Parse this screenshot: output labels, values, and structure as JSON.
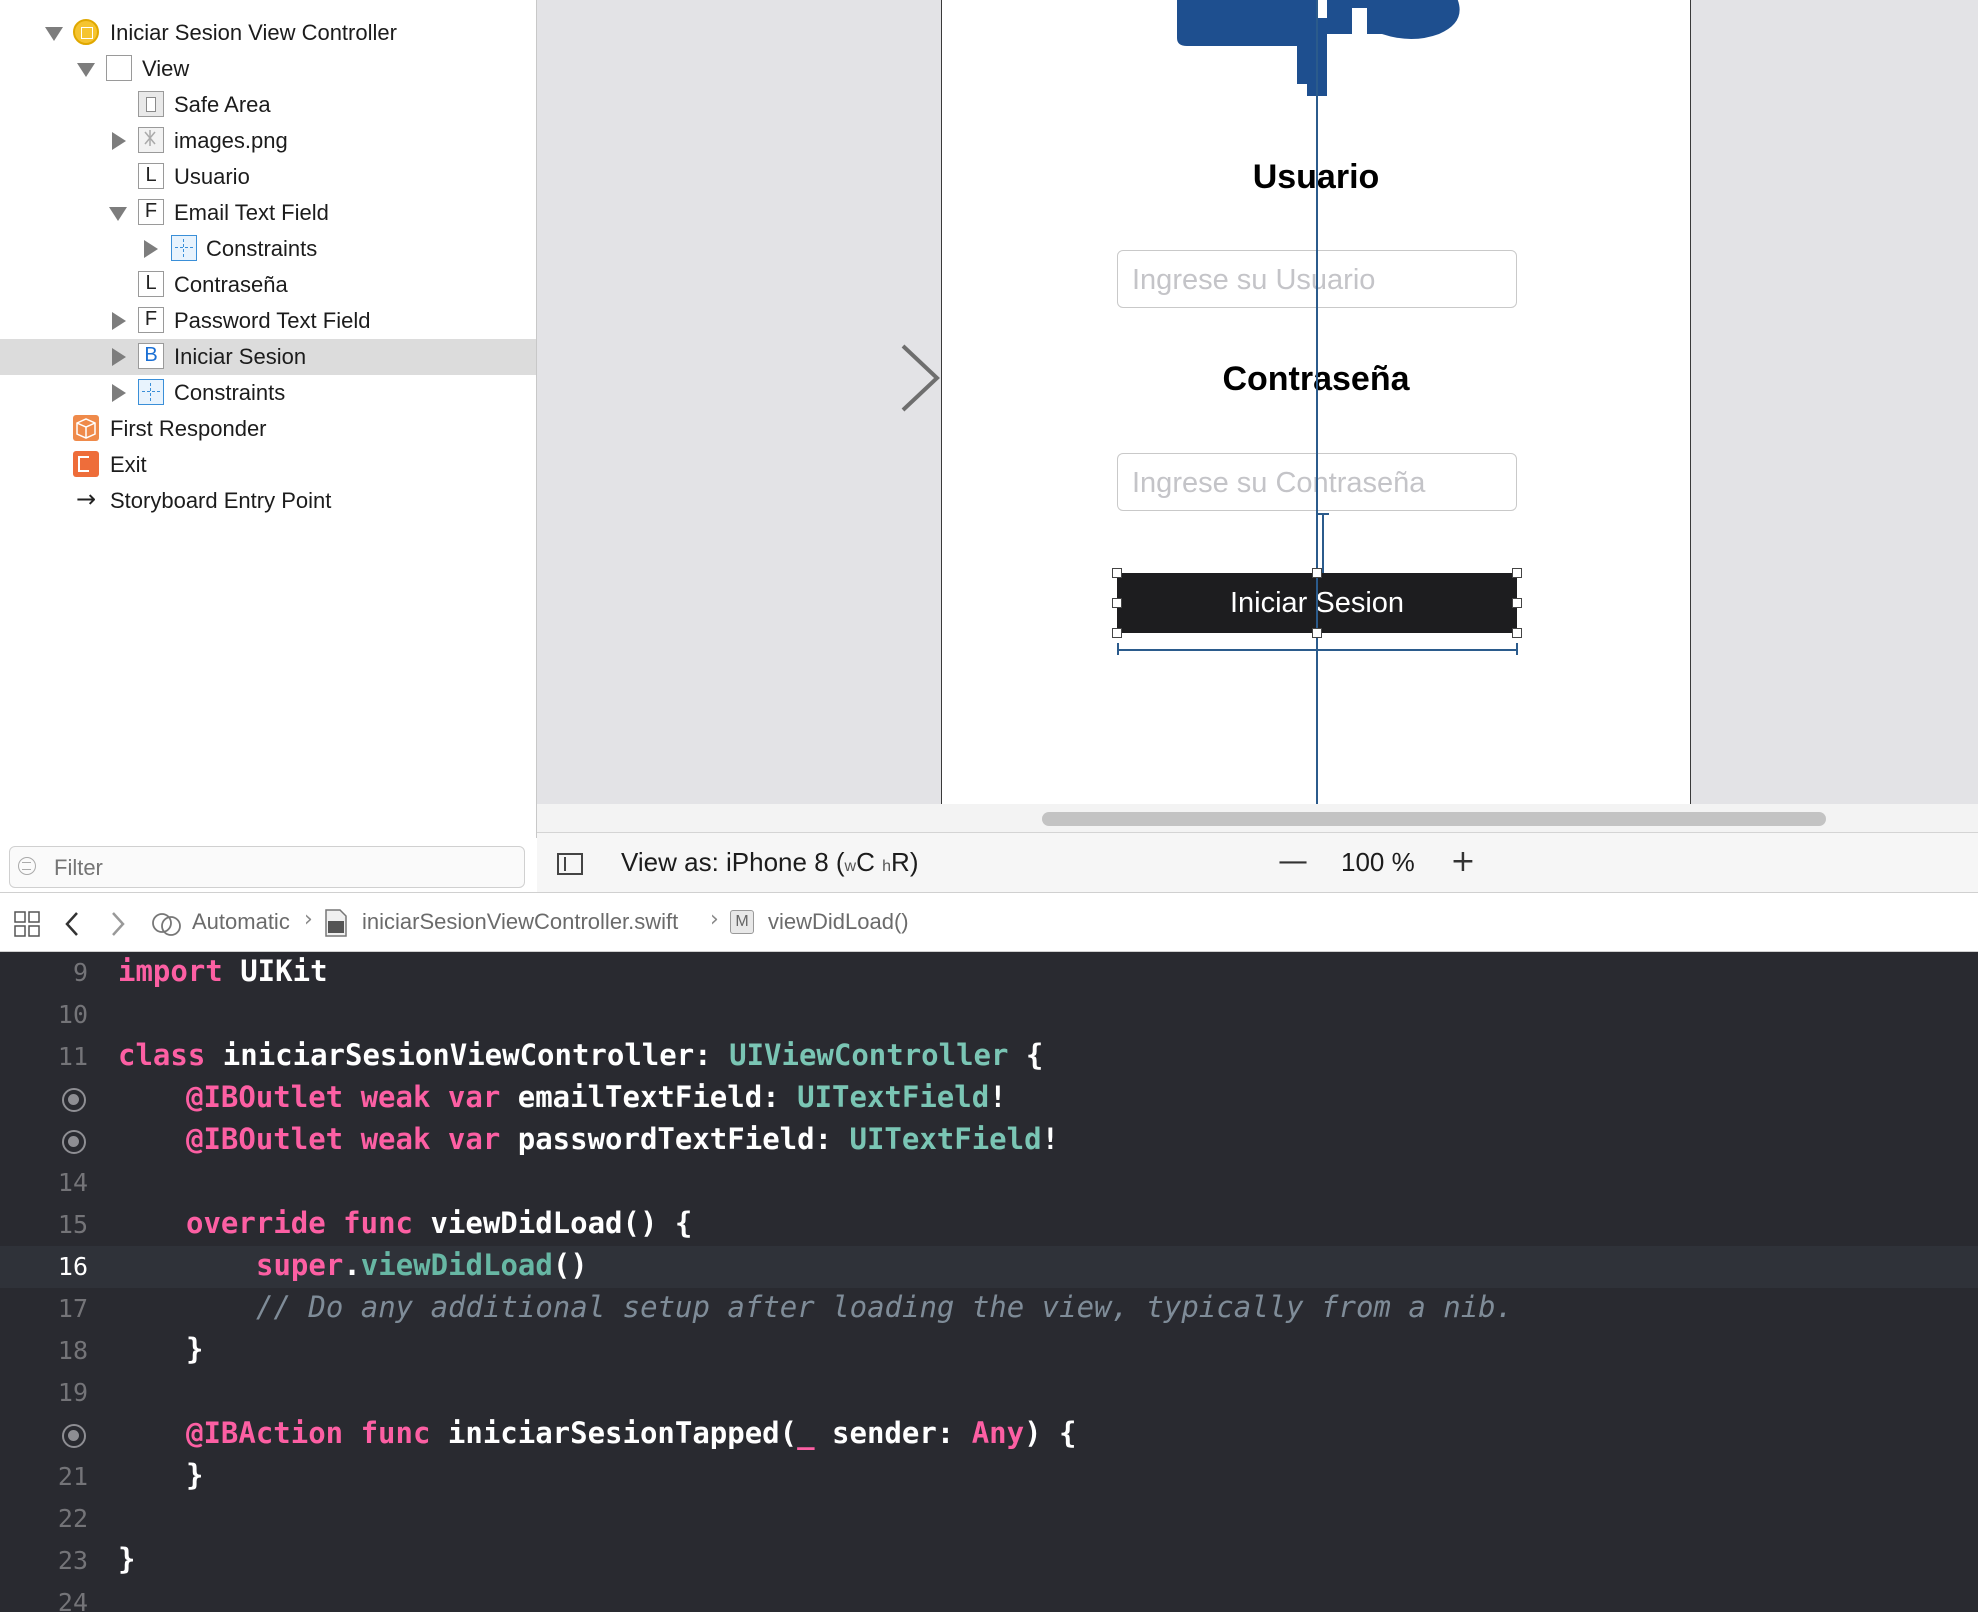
{
  "outline": {
    "items": [
      {
        "label": "Iniciar Sesion View Controller",
        "icon": "view-controller-icon"
      },
      {
        "label": "View",
        "icon": "view-icon"
      },
      {
        "label": "Safe Area",
        "icon": "safe-area-icon"
      },
      {
        "label": "images.png",
        "icon": "image-icon"
      },
      {
        "label": "Usuario",
        "icon": "label-icon",
        "badge": "L"
      },
      {
        "label": "Email Text Field",
        "icon": "text-field-icon",
        "badge": "F"
      },
      {
        "label": "Constraints",
        "icon": "constraints-icon"
      },
      {
        "label": "Contraseña",
        "icon": "label-icon",
        "badge": "L"
      },
      {
        "label": "Password Text Field",
        "icon": "text-field-icon",
        "badge": "F"
      },
      {
        "label": "Iniciar Sesion",
        "icon": "button-icon",
        "badge": "B",
        "selected": true
      },
      {
        "label": "Constraints",
        "icon": "constraints-icon"
      },
      {
        "label": "First Responder",
        "icon": "first-responder-icon"
      },
      {
        "label": "Exit",
        "icon": "exit-icon"
      },
      {
        "label": "Storyboard Entry Point",
        "icon": "arrow-right-icon"
      }
    ],
    "filter_placeholder": "Filter"
  },
  "canvas": {
    "usuario_label": "Usuario",
    "usuario_placeholder": "Ingrese su Usuario",
    "contrasena_label": "Contraseña",
    "contrasena_placeholder": "Ingrese su Contraseña",
    "button_label": "Iniciar Sesion",
    "logo_color": "#1e4f8f"
  },
  "toolbar": {
    "view_as_prefix": "View as: iPhone 8 (",
    "size_w": "w",
    "size_w_class": "C",
    "size_h": "h",
    "size_h_class": "R",
    "view_as_suffix": ")",
    "zoom_out": "—",
    "zoom_level": "100 %",
    "zoom_in": "+"
  },
  "jumpbar": {
    "automatic": "Automatic",
    "file": "iniciarSesionViewController.swift",
    "method_badge": "M",
    "method": "viewDidLoad()",
    "separator": "›"
  },
  "editor": {
    "lines": [
      {
        "num": "9"
      },
      {
        "num": "10"
      },
      {
        "num": "11"
      },
      {
        "num": "",
        "outlet": true
      },
      {
        "num": "",
        "outlet": true
      },
      {
        "num": "14"
      },
      {
        "num": "15"
      },
      {
        "num": "16",
        "current": true
      },
      {
        "num": "17"
      },
      {
        "num": "18"
      },
      {
        "num": "19"
      },
      {
        "num": "",
        "outlet": true
      },
      {
        "num": "21"
      },
      {
        "num": "22"
      },
      {
        "num": "23"
      },
      {
        "num": "24"
      }
    ],
    "tokens": {
      "import_kw": "import",
      "uikit": " UIKit",
      "class_kw": "class",
      "class_name": " iniciarSesionViewController: ",
      "superclass": "UIViewController",
      "brace_open": " {",
      "iboutlet": "@IBOutlet",
      "weak": " weak",
      "var": " var",
      "email_name": " emailTextField: ",
      "password_name": " passwordTextField: ",
      "textfield_type": "UITextField",
      "bang": "!",
      "override": "override",
      "func": " func",
      "viewdidload_decl": " viewDidLoad() {",
      "super_kw": "super",
      "dot": ".",
      "viewdidload_call": "viewDidLoad",
      "parens": "()",
      "comment": "// Do any additional setup after loading the view, typically from a nib.",
      "brace_close": "}",
      "ibaction": "@IBAction",
      "action_name": " iniciarSesionTapped(",
      "underscore": "_",
      "sender": " sender: ",
      "any": "Any",
      "action_end": ") {"
    }
  }
}
